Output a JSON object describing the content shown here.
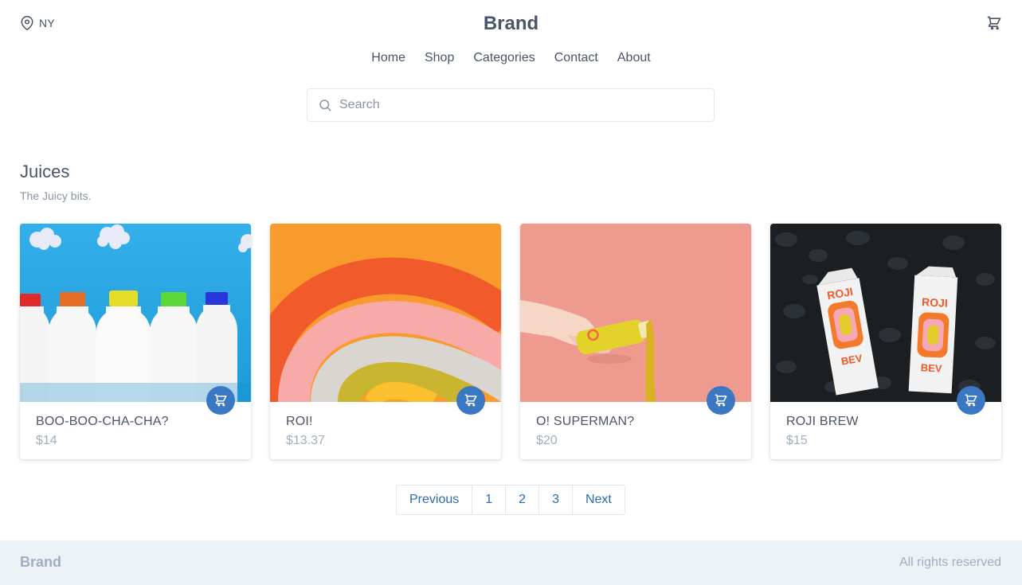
{
  "header": {
    "location": "NY",
    "brand": "Brand"
  },
  "nav": [
    "Home",
    "Shop",
    "Categories",
    "Contact",
    "About"
  ],
  "search": {
    "placeholder": "Search",
    "value": ""
  },
  "section": {
    "title": "Juices",
    "subtitle": "The Juicy bits."
  },
  "products": [
    {
      "name": "BOO-BOO-CHA-CHA?",
      "price": "$14"
    },
    {
      "name": "ROI!",
      "price": "$13.37"
    },
    {
      "name": "O! SUPERMAN?",
      "price": "$20"
    },
    {
      "name": "ROJI BREW",
      "price": "$15"
    }
  ],
  "product_images": {
    "card4_carton_text": [
      "ROJI",
      "BEV"
    ]
  },
  "pagination": {
    "previous": "Previous",
    "pages": [
      "1",
      "2",
      "3"
    ],
    "next": "Next"
  },
  "footer": {
    "brand": "Brand",
    "rights": "All rights reserved"
  },
  "colors": {
    "accent": "#3b78c4",
    "link": "#2b6cb0",
    "text": "#4a5568",
    "muted": "#a0aec0",
    "footer_bg": "#edf2f7"
  },
  "icons": {
    "location": "map-pin-icon",
    "cart": "cart-icon",
    "search": "search-icon"
  }
}
